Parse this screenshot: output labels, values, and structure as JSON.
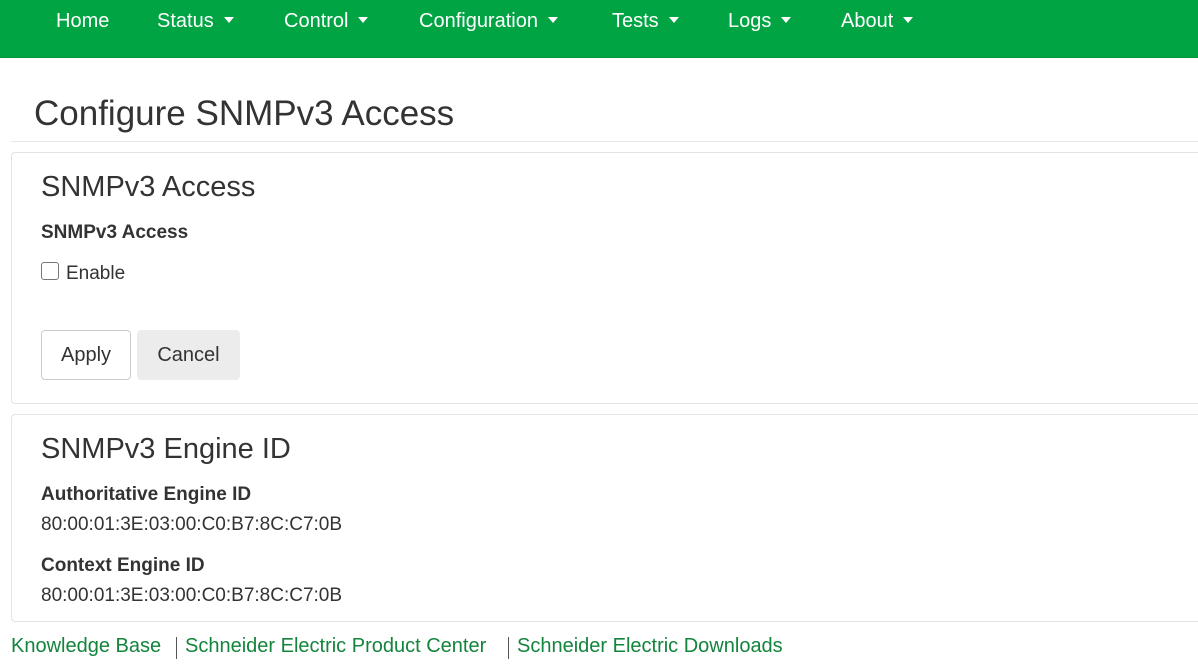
{
  "nav": {
    "items": [
      {
        "label": "Home",
        "has_menu": false
      },
      {
        "label": "Status",
        "has_menu": true
      },
      {
        "label": "Control",
        "has_menu": true
      },
      {
        "label": "Configuration",
        "has_menu": true
      },
      {
        "label": "Tests",
        "has_menu": true
      },
      {
        "label": "Logs",
        "has_menu": true
      },
      {
        "label": "About",
        "has_menu": true
      }
    ],
    "bg_color": "#00a443"
  },
  "page": {
    "title": "Configure SNMPv3 Access"
  },
  "access_panel": {
    "heading": "SNMPv3 Access",
    "field_label": "SNMPv3 Access",
    "checkbox_label": "Enable",
    "checkbox_checked": false,
    "apply_label": "Apply",
    "cancel_label": "Cancel"
  },
  "engine_panel": {
    "heading": "SNMPv3 Engine ID",
    "authoritative_label": "Authoritative Engine ID",
    "authoritative_value": "80:00:01:3E:03:00:C0:B7:8C:C7:0B",
    "context_label": "Context Engine ID",
    "context_value": "80:00:01:3E:03:00:C0:B7:8C:C7:0B"
  },
  "footer": {
    "links": [
      {
        "label": "Knowledge Base"
      },
      {
        "label": "Schneider Electric Product Center"
      },
      {
        "label": "Schneider Electric Downloads"
      }
    ],
    "link_color": "#12843c"
  }
}
